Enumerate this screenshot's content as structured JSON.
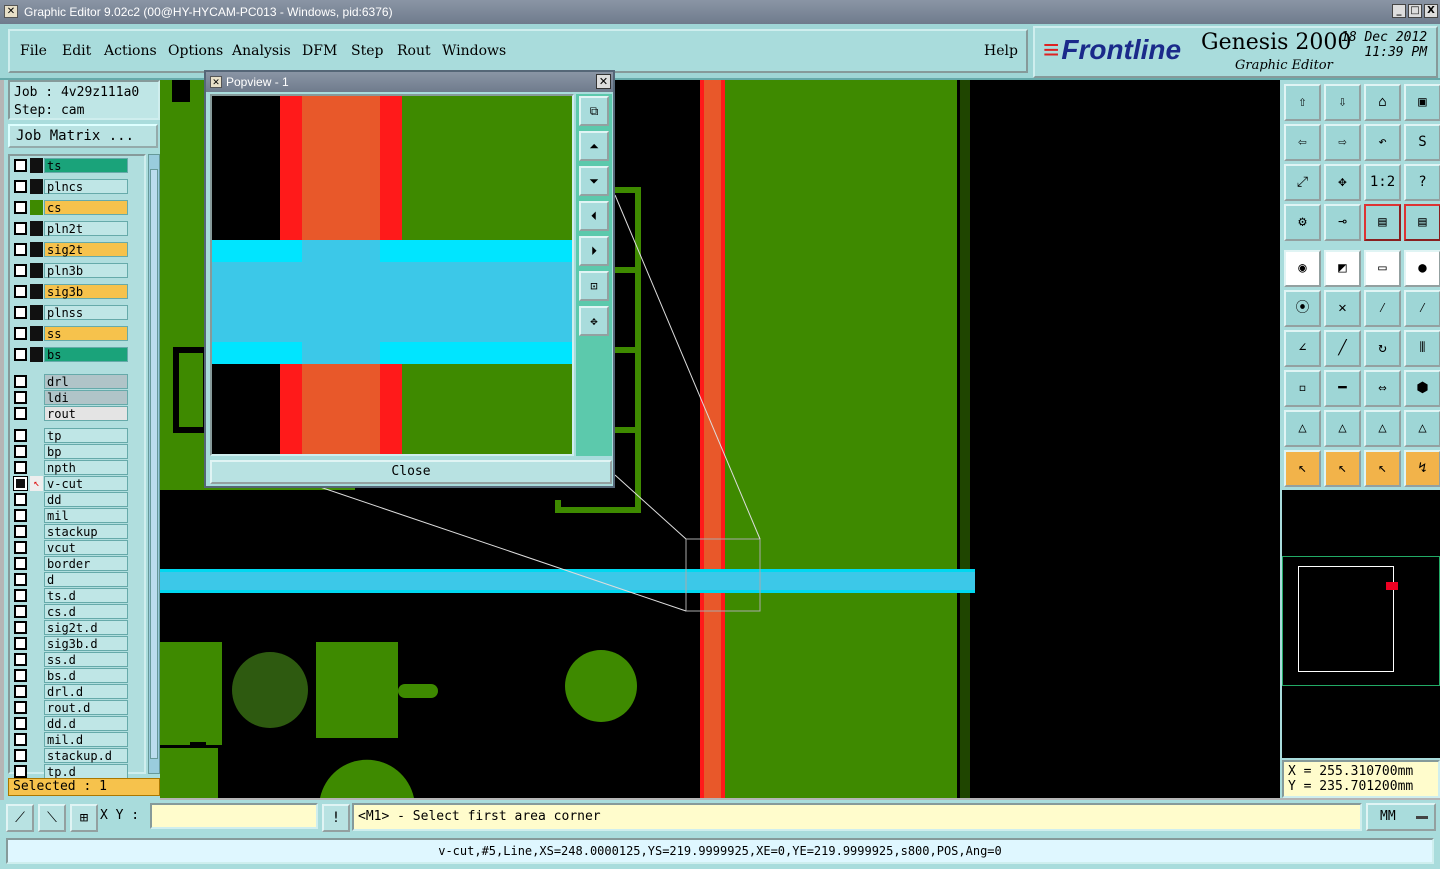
{
  "window": {
    "title": "Graphic Editor 9.02c2 (00@HY-HYCAM-PC013 - Windows, pid:6376)",
    "buttons": [
      "_",
      "□",
      "X"
    ]
  },
  "menu": {
    "items": [
      "File",
      "Edit",
      "Actions",
      "Options",
      "Analysis",
      "DFM",
      "Step",
      "Rout",
      "Windows"
    ],
    "help": "Help"
  },
  "brand": {
    "logo": "Frontline",
    "product": "Genesis 2000",
    "subtitle": "Graphic Editor",
    "date": "18 Dec 2012",
    "time": "11:39 PM"
  },
  "job": {
    "job_line": "Job : 4v29z111a0",
    "step_line": "Step: cam",
    "matrix_button": "Job Matrix ..."
  },
  "layers": [
    {
      "name": "ts",
      "color": "#1aa37a"
    },
    {
      "name": "plncs",
      "color": "#bfe6e6"
    },
    {
      "name": "cs",
      "color": "#f6c24c"
    },
    {
      "name": "pln2t",
      "color": "#bfe6e6"
    },
    {
      "name": "sig2t",
      "color": "#f6c24c"
    },
    {
      "name": "pln3b",
      "color": "#bfe6e6"
    },
    {
      "name": "sig3b",
      "color": "#f6c24c"
    },
    {
      "name": "plnss",
      "color": "#bfe6e6"
    },
    {
      "name": "ss",
      "color": "#f6c24c"
    },
    {
      "name": "bs",
      "color": "#1aa37a"
    },
    {
      "name": "drl",
      "color": "#b0c4c8"
    },
    {
      "name": "ldi",
      "color": "#b0c4c8"
    },
    {
      "name": "rout",
      "color": "#e4e4e4"
    },
    {
      "name": "tp",
      "color": "#bfe6e6"
    },
    {
      "name": "bp",
      "color": "#bfe6e6"
    },
    {
      "name": "npth",
      "color": "#bfe6e6"
    },
    {
      "name": "v-cut",
      "color": "#bfe6e6",
      "active": true
    },
    {
      "name": "dd",
      "color": "#bfe6e6"
    },
    {
      "name": "mil",
      "color": "#bfe6e6"
    },
    {
      "name": "stackup",
      "color": "#bfe6e6"
    },
    {
      "name": "vcut",
      "color": "#bfe6e6"
    },
    {
      "name": "border",
      "color": "#bfe6e6"
    },
    {
      "name": "d",
      "color": "#bfe6e6"
    },
    {
      "name": "ts.d",
      "color": "#bfe6e6"
    },
    {
      "name": "cs.d",
      "color": "#bfe6e6"
    },
    {
      "name": "sig2t.d",
      "color": "#bfe6e6"
    },
    {
      "name": "sig3b.d",
      "color": "#bfe6e6"
    },
    {
      "name": "ss.d",
      "color": "#bfe6e6"
    },
    {
      "name": "bs.d",
      "color": "#bfe6e6"
    },
    {
      "name": "drl.d",
      "color": "#bfe6e6"
    },
    {
      "name": "rout.d",
      "color": "#bfe6e6"
    },
    {
      "name": "dd.d",
      "color": "#bfe6e6"
    },
    {
      "name": "mil.d",
      "color": "#bfe6e6"
    },
    {
      "name": "stackup.d",
      "color": "#bfe6e6"
    },
    {
      "name": "tp.d",
      "color": "#bfe6e6"
    }
  ],
  "selected": "Selected : 1",
  "popview": {
    "title": "Popview - 1",
    "close_button": "Close"
  },
  "coords": {
    "x": "X = 255.310700mm",
    "y": "Y = 235.701200mm"
  },
  "bottom": {
    "xy_label": "X Y :",
    "xy_value": "",
    "prompt": "<M1> - Select first area corner",
    "units": "MM"
  },
  "status": "v-cut,#5,Line,XS=248.0000125,YS=219.9999925,XE=0,YE=219.9999925,s800,POS,Ang=0",
  "toolbar": {
    "zoom_row_1": [
      "1:2",
      "?"
    ],
    "colors": {
      "cyan_board": "#a9dcdc",
      "copper_green": "#3e8a00",
      "vcut_cyan": "#00e5ff",
      "red_line": "#ff1a1a",
      "orange": "#e8582a"
    }
  }
}
